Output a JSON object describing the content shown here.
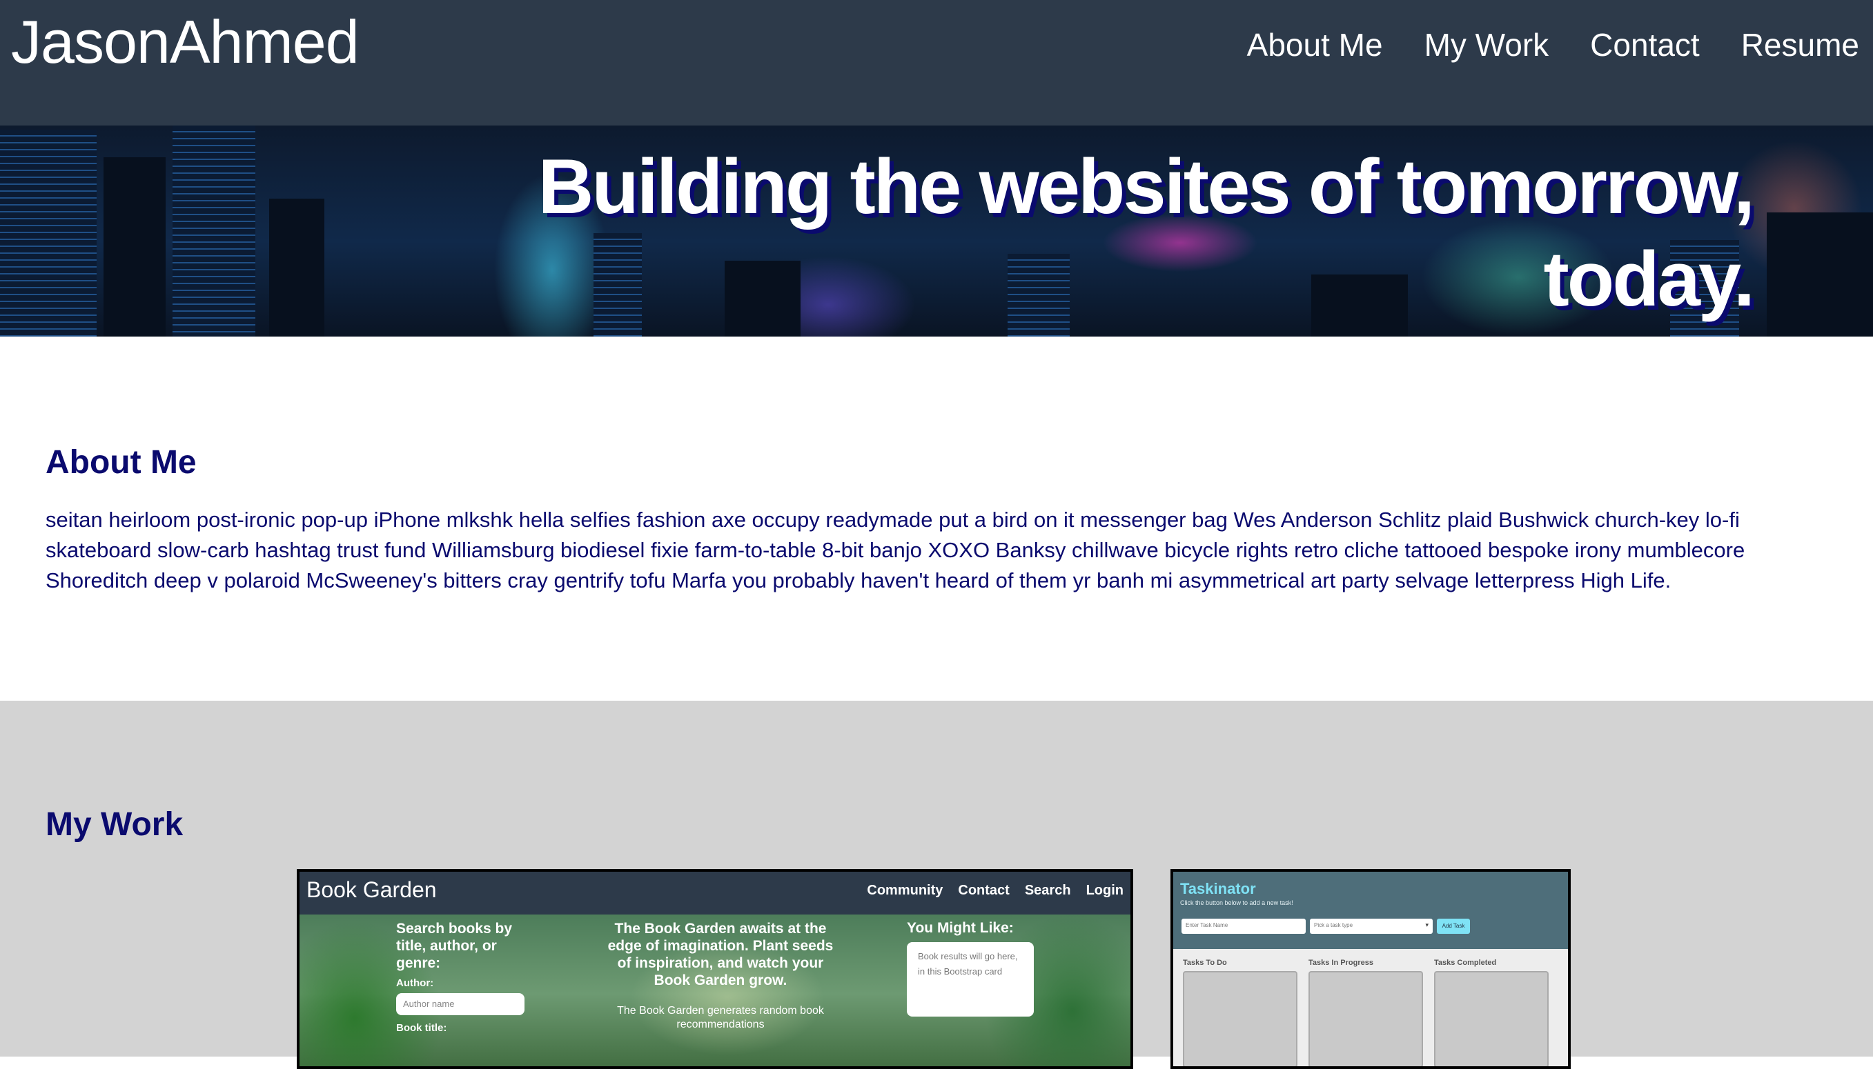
{
  "header": {
    "brand": "JasonAhmed",
    "nav": [
      "About Me",
      "My Work",
      "Contact",
      "Resume"
    ]
  },
  "hero": {
    "title": "Building the websites of tomorrow, today."
  },
  "about": {
    "heading": "About Me",
    "text": "seitan heirloom post-ironic pop-up iPhone mlkshk hella selfies fashion axe occupy readymade put a bird on it messenger bag Wes Anderson Schlitz plaid Bushwick church-key lo-fi skateboard slow-carb hashtag trust fund Williamsburg biodiesel fixie farm-to-table 8-bit banjo XOXO Banksy chillwave bicycle rights retro cliche tattooed bespoke irony mumblecore Shoreditch deep v polaroid McSweeney's bitters cray gentrify tofu Marfa you probably haven't heard of them yr banh mi asymmetrical art party selvage letterpress High Life."
  },
  "work": {
    "heading": "My Work",
    "book_garden": {
      "brand": "Book Garden",
      "nav": [
        "Community",
        "Contact",
        "Search",
        "Login"
      ],
      "search_title": "Search books by title, author, or genre:",
      "author_label": "Author:",
      "author_placeholder": "Author name",
      "book_title_label": "Book title:",
      "mid_main": "The Book Garden awaits at the edge of imagination. Plant seeds of inspiration, and watch your Book Garden grow.",
      "mid_sub": "The Book Garden generates random book recommendations",
      "like_title": "You Might Like:",
      "results_text": "Book results will go here, in this Bootstrap card"
    },
    "taskinator": {
      "title": "Taskinator",
      "subtitle": "Click the button below to add a new task!",
      "task_placeholder": "Enter Task Name",
      "type_placeholder": "Pick a task type",
      "add_label": "Add Task",
      "columns": [
        "Tasks To Do",
        "Tasks In Progress",
        "Tasks Completed"
      ]
    }
  },
  "colors": {
    "header_bg": "#2d3a4a",
    "heading": "#0a0a6e",
    "work_bg": "#d3d3d3"
  }
}
